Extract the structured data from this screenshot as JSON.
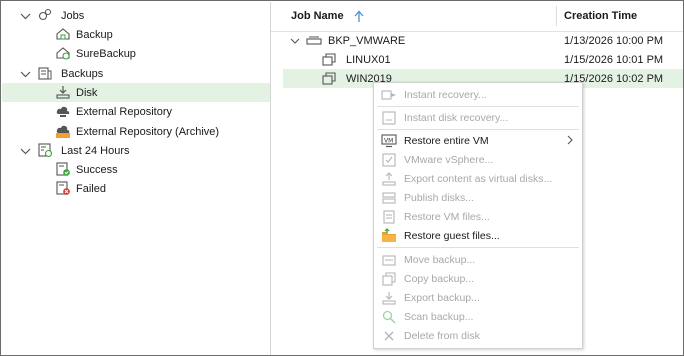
{
  "tree": {
    "jobs": {
      "label": "Jobs",
      "expanded": true,
      "children": [
        "Backup",
        "SureBackup"
      ]
    },
    "backups": {
      "label": "Backups",
      "expanded": true,
      "children": [
        "Disk",
        "External Repository",
        "External Repository (Archive)"
      ],
      "selected": "Disk"
    },
    "last24": {
      "label": "Last 24 Hours",
      "expanded": true,
      "children": [
        "Success",
        "Failed"
      ]
    }
  },
  "grid": {
    "columns": [
      "Job Name",
      "Creation Time"
    ],
    "sort": {
      "column": "Job Name",
      "direction": "ascending"
    },
    "rows": [
      {
        "name": "BKP_VMWARE",
        "time": "1/13/2026 10:00 PM",
        "expanded": true,
        "level": 0
      },
      {
        "name": "LINUX01",
        "time": "1/15/2026 10:01 PM",
        "level": 1
      },
      {
        "name": "WIN2019",
        "time": "1/15/2026 10:02 PM",
        "level": 1,
        "selected": true
      }
    ]
  },
  "context_menu": {
    "items": [
      {
        "label": "Instant recovery...",
        "enabled": false,
        "icon": "instant-recovery-icon"
      },
      {
        "separator": true
      },
      {
        "label": "Instant disk recovery...",
        "enabled": false,
        "icon": "instant-disk-recovery-icon"
      },
      {
        "separator": true
      },
      {
        "label": "Restore entire VM",
        "enabled": true,
        "icon": "vm-icon",
        "submenu": true
      },
      {
        "label": "VMware vSphere...",
        "enabled": false,
        "icon": "vsphere-icon"
      },
      {
        "label": "Export content as virtual disks...",
        "enabled": false,
        "icon": "export-disks-icon"
      },
      {
        "label": "Publish disks...",
        "enabled": false,
        "icon": "publish-disks-icon"
      },
      {
        "label": "Restore VM files...",
        "enabled": false,
        "icon": "restore-vm-files-icon"
      },
      {
        "label": "Restore guest files...",
        "enabled": true,
        "icon": "folder-icon"
      },
      {
        "separator": true
      },
      {
        "label": "Move backup...",
        "enabled": false,
        "icon": "move-backup-icon"
      },
      {
        "label": "Copy backup...",
        "enabled": false,
        "icon": "copy-backup-icon"
      },
      {
        "label": "Export backup...",
        "enabled": false,
        "icon": "export-backup-icon"
      },
      {
        "label": "Scan backup...",
        "enabled": false,
        "icon": "scan-backup-icon"
      },
      {
        "label": "Delete from disk",
        "enabled": false,
        "icon": "delete-icon"
      }
    ]
  },
  "colors": {
    "selection": "#e4f2e4",
    "accent_green": "#3aa23a",
    "sort_arrow": "#4a90d9",
    "disabled_text": "#a8a8a8",
    "folder_orange": "#f0a030",
    "failed_red": "#d0342c"
  }
}
